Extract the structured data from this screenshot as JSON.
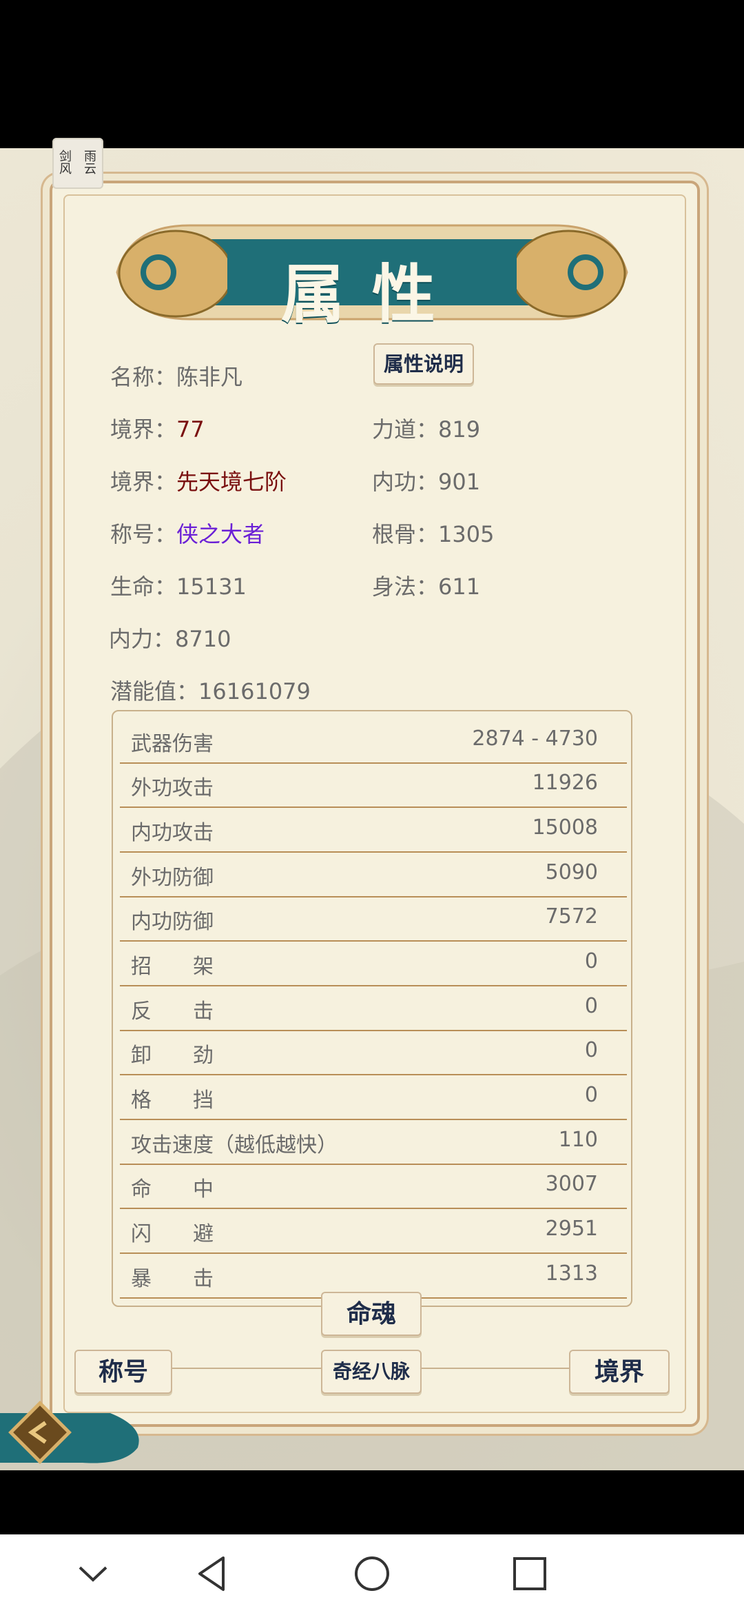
{
  "app": {
    "logo_text": [
      "剑",
      "雨",
      "风",
      "云"
    ]
  },
  "title": "属性",
  "explain_button": "属性说明",
  "stats": {
    "name": {
      "label": "名称：",
      "value": "陈非凡"
    },
    "level": {
      "label": "境界：",
      "value": "77"
    },
    "strength": {
      "label": "力道：",
      "value": "819"
    },
    "realm": {
      "label": "境界：",
      "value": "先天境七阶"
    },
    "inner_skill": {
      "label": "内功：",
      "value": "901"
    },
    "honor": {
      "label": "称号：",
      "value": "侠之大者"
    },
    "constitution": {
      "label": "根骨：",
      "value": "1305"
    },
    "hp": {
      "label": "生命：",
      "value": "15131"
    },
    "agility": {
      "label": "身法：",
      "value": "611"
    },
    "mp": {
      "label": "内力：",
      "value": "8710"
    },
    "potential": {
      "label": "潜能值：",
      "value": "16161079"
    }
  },
  "attributes": [
    {
      "label": "武器伤害",
      "value": "2874 - 4730"
    },
    {
      "label": "外功攻击",
      "value": "11926"
    },
    {
      "label": "内功攻击",
      "value": "15008"
    },
    {
      "label": "外功防御",
      "value": "5090"
    },
    {
      "label": "内功防御",
      "value": "7572"
    },
    {
      "label": "招　　架",
      "value": "0"
    },
    {
      "label": "反　　击",
      "value": "0"
    },
    {
      "label": "卸　　劲",
      "value": "0"
    },
    {
      "label": "格　　挡",
      "value": "0"
    },
    {
      "label": "攻击速度（越低越快）",
      "value": "110"
    },
    {
      "label": "命　　中",
      "value": "3007"
    },
    {
      "label": "闪　　避",
      "value": "2951"
    },
    {
      "label": "暴　　击",
      "value": "1313"
    }
  ],
  "buttons": {
    "soul": "命魂",
    "title": "称号",
    "meridians": "奇经八脉",
    "realm": "境界"
  },
  "colors": {
    "banner": "#1f6f78",
    "gold": "#d8b06a",
    "realm_text": "#7a1010",
    "title_text": "#6a1fd6"
  }
}
